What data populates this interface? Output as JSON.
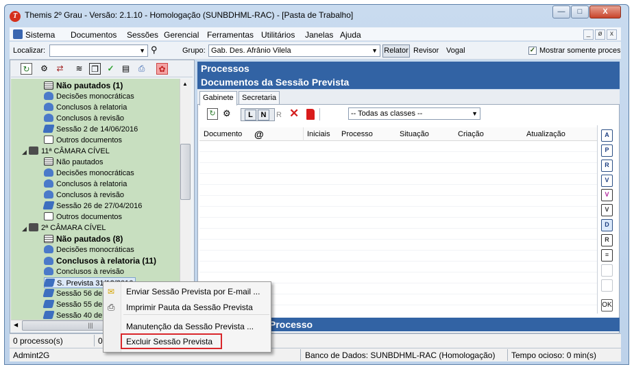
{
  "window": {
    "title": "Themis 2º Grau - Versão: 2.1.10 - Homologação (SUNBDHML-RAC) - [Pasta de Trabalho]",
    "icon_letter": "T",
    "controls": [
      "minimize-icon",
      "maximize-icon",
      "close-icon"
    ],
    "close_glyph": "X"
  },
  "menubar": {
    "items": [
      "Sistema",
      "Documentos",
      "Sessões",
      "Gerencial",
      "Ferramentas",
      "Utilitários",
      "Janelas",
      "Ajuda"
    ],
    "mdi_controls": [
      "_",
      "ø",
      "x"
    ]
  },
  "toolbar": {
    "localizar_label": "Localizar:",
    "localizar_value": "",
    "grupo_label": "Grupo:",
    "grupo_value": "Gab. Des. Afrânio Vilela",
    "relator_label": "Relator",
    "revisor_label": "Revisor",
    "vogal_label": "Vogal",
    "mostrar_label": "Mostrar somente process",
    "mostrar_checked": true
  },
  "tree": {
    "items": [
      {
        "label": "Não pautados (1)",
        "bold": true,
        "icon": "list-icon",
        "indent": 2
      },
      {
        "label": "Decisões monocráticas",
        "bold": false,
        "icon": "user-icon",
        "indent": 2
      },
      {
        "label": "Conclusos à relatoria",
        "bold": false,
        "icon": "user-icon",
        "indent": 2
      },
      {
        "label": "Conclusos à revisão",
        "bold": false,
        "icon": "user-icon",
        "indent": 2
      },
      {
        "label": "Sessão 2 de 14/06/2016",
        "bold": false,
        "icon": "session-icon",
        "indent": 2
      },
      {
        "label": "Outros documentos",
        "bold": false,
        "icon": "document-icon",
        "indent": 2
      },
      {
        "label": "11ª CÂMARA CÍVEL",
        "bold": false,
        "icon": "chamber-icon",
        "indent": 1
      },
      {
        "label": "Não pautados",
        "bold": false,
        "icon": "list-icon",
        "indent": 2
      },
      {
        "label": "Decisões monocráticas",
        "bold": false,
        "icon": "user-icon",
        "indent": 2
      },
      {
        "label": "Conclusos à relatoria",
        "bold": false,
        "icon": "user-icon",
        "indent": 2
      },
      {
        "label": "Conclusos à revisão",
        "bold": false,
        "icon": "user-icon",
        "indent": 2
      },
      {
        "label": "Sessão 26 de 27/04/2016",
        "bold": false,
        "icon": "session-icon",
        "indent": 2
      },
      {
        "label": "Outros documentos",
        "bold": false,
        "icon": "document-icon",
        "indent": 2
      },
      {
        "label": "2ª CÂMARA CÍVEL",
        "bold": false,
        "icon": "chamber-icon",
        "indent": 1
      },
      {
        "label": "Não pautados (8)",
        "bold": true,
        "icon": "list-icon",
        "indent": 2
      },
      {
        "label": "Decisões monocráticas",
        "bold": false,
        "icon": "user-icon",
        "indent": 2
      },
      {
        "label": "Conclusos à relatoria (11)",
        "bold": true,
        "icon": "user-icon",
        "indent": 2
      },
      {
        "label": "Conclusos à revisão",
        "bold": false,
        "icon": "user-icon",
        "indent": 2
      },
      {
        "label": "S. Prevista 31/12/2016",
        "bold": false,
        "icon": "session-icon",
        "indent": 2,
        "selected": true
      },
      {
        "label": "Sessão 56 de",
        "bold": false,
        "icon": "session-icon",
        "indent": 2
      },
      {
        "label": "Sessão 55 de",
        "bold": false,
        "icon": "session-icon",
        "indent": 2
      },
      {
        "label": "Sessão 40 de",
        "bold": false,
        "icon": "session-icon",
        "indent": 2
      }
    ]
  },
  "right": {
    "processos_header": "Processos",
    "docs_header": "Documentos da Sessão Prevista",
    "bottom_header": "Processo",
    "tabs": [
      "Gabinete",
      "Secretaria"
    ],
    "active_tab": "Gabinete",
    "class_filter": "-- Todas as classes --",
    "fmt_buttons": [
      "L",
      "N",
      "R"
    ],
    "columns": [
      "Documento",
      "@",
      "Iniciais",
      "Processo",
      "Situação",
      "Criação",
      "Atualização"
    ],
    "side_buttons": [
      "A",
      "P",
      "R",
      "V",
      "V",
      "V",
      "D",
      "R",
      "",
      "",
      "",
      "OK"
    ]
  },
  "status": {
    "processos": "0 processo(s)",
    "count2": "0",
    "user": "Admint2G",
    "database": "Banco de Dados: SUNBDHML-RAC (Homologação)",
    "idle": "Tempo ocioso: 0 min(s)"
  },
  "context_menu": {
    "items": [
      {
        "label": "Enviar Sessão Prevista por E-mail ...",
        "icon": "envelope-icon"
      },
      {
        "label": "Imprimir Pauta da Sessão Prevista",
        "icon": "printer-icon"
      },
      {
        "label": "Manutenção da Sessão Prevista ...",
        "icon": ""
      },
      {
        "label": "Excluir Sessão Prevista",
        "icon": "",
        "highlighted": true
      }
    ]
  },
  "colors": {
    "header_blue": "#3263a4",
    "tree_green": "#c8dfc0",
    "highlight_red": "#d9262a"
  }
}
